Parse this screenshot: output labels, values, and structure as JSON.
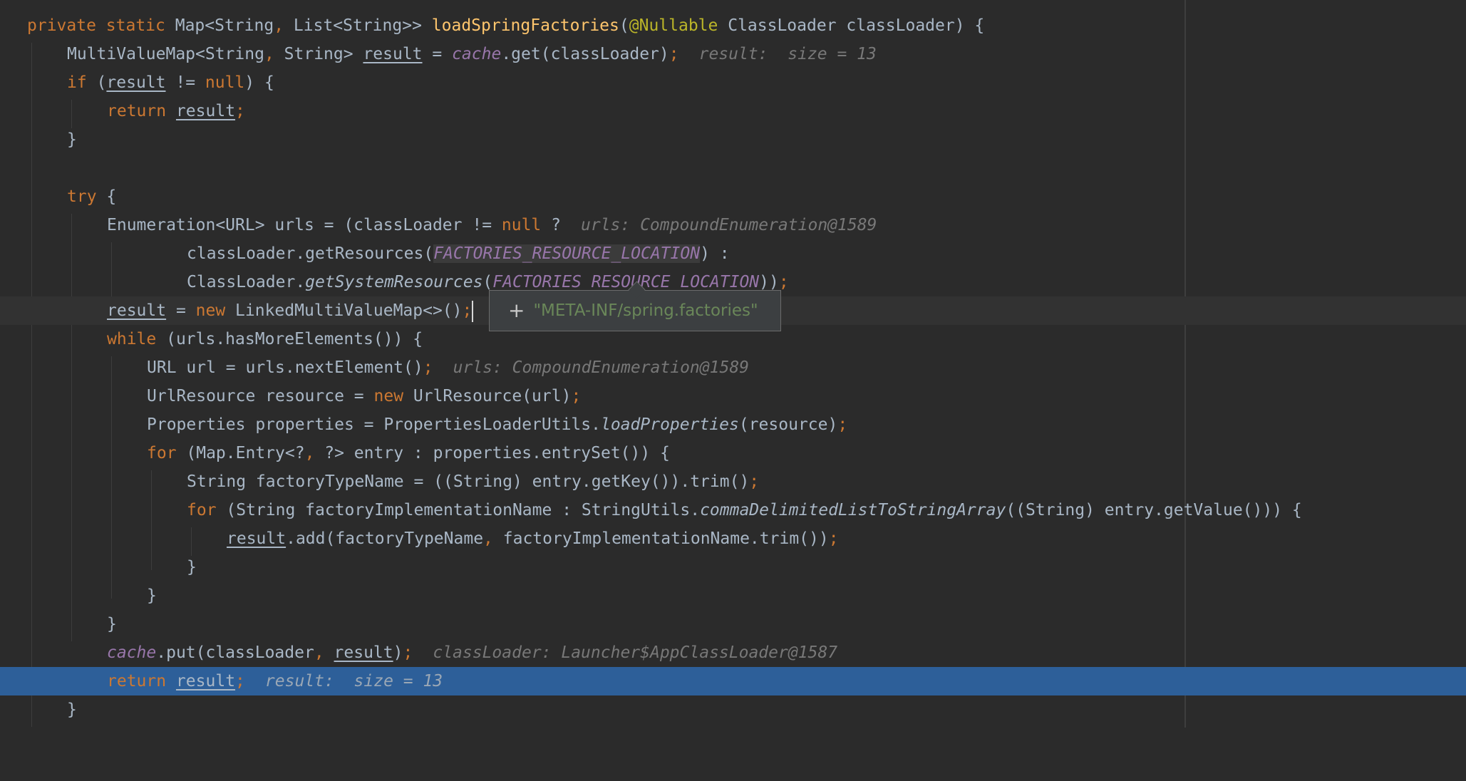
{
  "editor": {
    "lines": [
      "private static Map<String, List<String>> loadSpringFactories(@Nullable ClassLoader classLoader) {",
      "MultiValueMap<String, String> result = cache.get(classLoader);",
      "if (result != null) {",
      "return result;",
      "}",
      "",
      "try {",
      "Enumeration<URL> urls = (classLoader != null ?",
      "classLoader.getResources(FACTORIES_RESOURCE_LOCATION) :",
      "ClassLoader.getSystemResources(FACTORIES_RESOURCE_LOCATION));",
      "result = new LinkedMultiValueMap<>();",
      "while (urls.hasMoreElements()) {",
      "URL url = urls.nextElement();",
      "UrlResource resource = new UrlResource(url);",
      "Properties properties = PropertiesLoaderUtils.loadProperties(resource);",
      "for (Map.Entry<?, ?> entry : properties.entrySet()) {",
      "String factoryTypeName = ((String) entry.getKey()).trim();",
      "for (String factoryImplementationName : StringUtils.commaDelimitedListToStringArray((String) entry.getValue())) {",
      "result.add(factoryTypeName, factoryImplementationName.trim());",
      "}",
      "}",
      "}",
      "cache.put(classLoader, result);",
      "return result;",
      "}"
    ],
    "hints": {
      "line2": "result:  size = 13",
      "line8": "urls: CompoundEnumeration@1589",
      "line13": "urls: CompoundEnumeration@1589",
      "line23": "classLoader: Launcher$AppClassLoader@1587",
      "line24": "result:  size = 13"
    }
  },
  "tooltip": {
    "expand_symbol": "+",
    "value": "\"META-INF/spring.factories\""
  },
  "colors": {
    "background": "#2b2b2b",
    "keyword": "#cc7832",
    "method_declaration": "#ffc66d",
    "annotation": "#bbb529",
    "field": "#9876aa",
    "string": "#6a8759",
    "execution_line": "#2d5f99",
    "inline_hint": "#787878"
  }
}
